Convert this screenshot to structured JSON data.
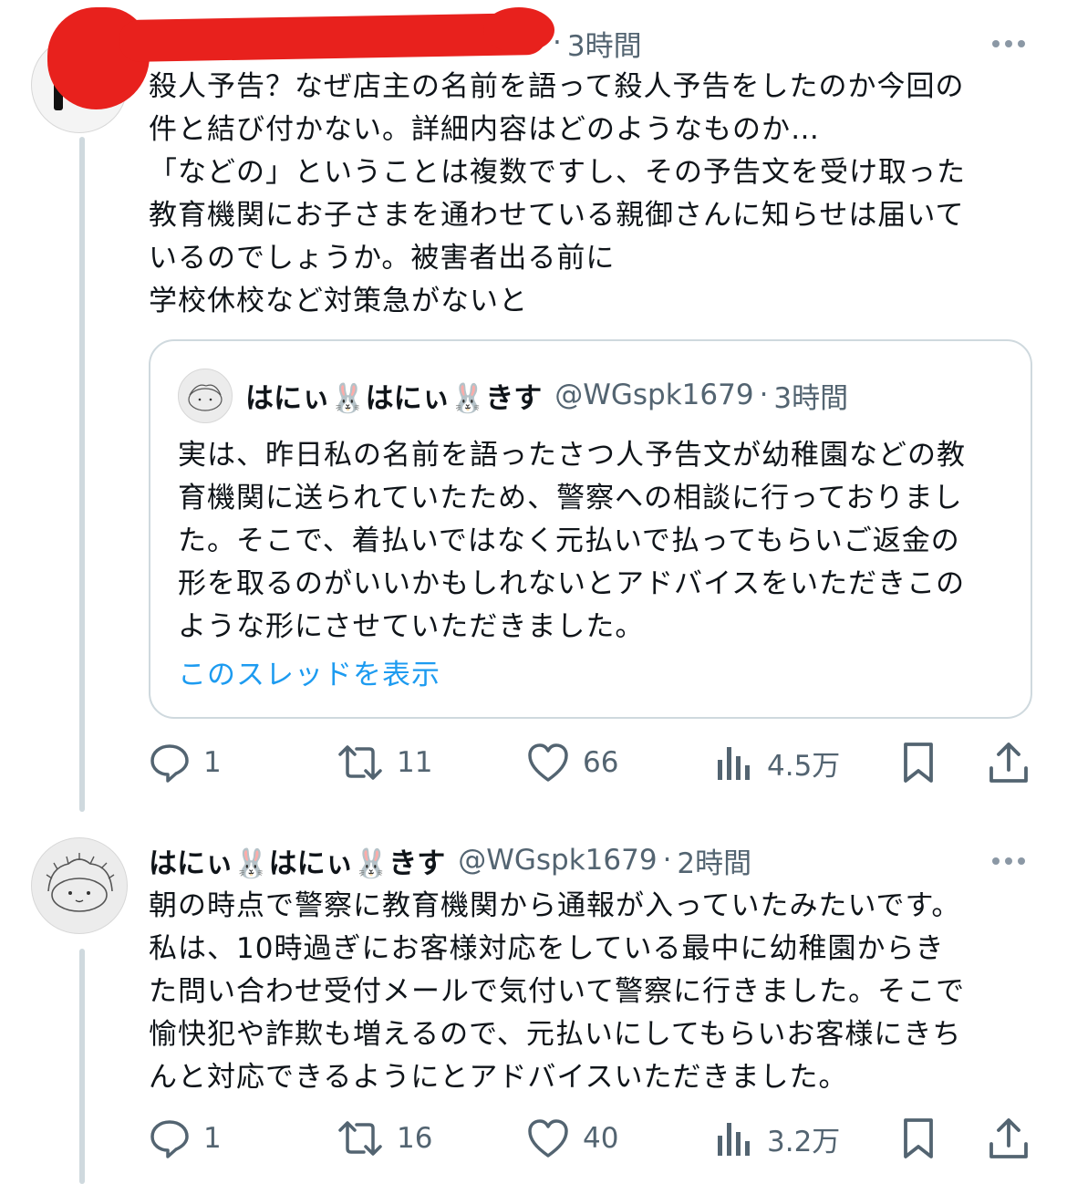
{
  "tweet1": {
    "time": "3時間",
    "text": "殺人予告？なぜ店主の名前を語って殺人予告をしたのか今回の\n件と結び付かない。詳細内容はどのようなものか…\n「などの」ということは複数ですし、その予告文を受け取った\n教育機関にお子さまを通わせている親御さんに知らせは届いて\nいるのでしょうか。被害者出る前に\n学校休校など対策急がないと",
    "stats": {
      "replies": "1",
      "retweets": "11",
      "likes": "66",
      "views": "4.5万"
    }
  },
  "quote": {
    "name": "はにぃ🐰はにぃ🐰きす",
    "handle": "@WGspk1679",
    "time": "3時間",
    "text": "実は、昨日私の名前を語ったさつ人予告文が幼稚園などの教\n育機関に送られていたため、警察への相談に行っておりまし\nた。そこで、着払いではなく元払いで払ってもらいご返金の\n形を取るのがいいかもしれないとアドバイスをいただきこの\nような形にさせていただきました。",
    "show_thread": "このスレッドを表示"
  },
  "tweet2": {
    "name": "はにぃ🐰はにぃ🐰きす",
    "handle": "@WGspk1679",
    "time": "2時間",
    "text": "朝の時点で警察に教育機関から通報が入っていたみたいです。\n私は、10時過ぎにお客様対応をしている最中に幼稚園からき\nた問い合わせ受付メールで気付いて警察に行きました。そこで\n愉快犯や詐欺も増えるので、元払いにしてもらいお客様にきち\nんと対応できるようにとアドバイスいただきました。",
    "stats": {
      "replies": "1",
      "retweets": "16",
      "likes": "40",
      "views": "3.2万"
    }
  },
  "colors": {
    "accent": "#1d9bf0",
    "muted": "#536471",
    "redaction": "#e8211d"
  },
  "icons": [
    "reply-icon",
    "retweet-icon",
    "like-icon",
    "views-icon",
    "bookmark-icon",
    "share-icon",
    "more-icon"
  ]
}
